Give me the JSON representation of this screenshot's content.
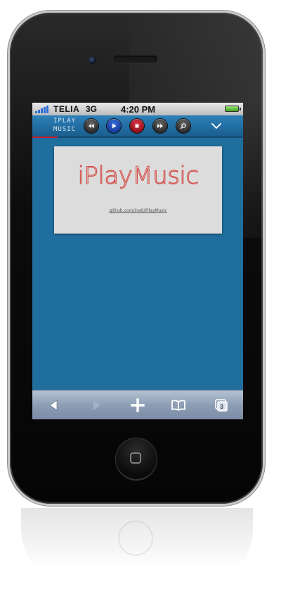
{
  "status_bar": {
    "carrier": "TELIA",
    "network": "3G",
    "time": "4:20 PM"
  },
  "player": {
    "logo_line1": "IPLAY",
    "logo_line2": "MUSIC",
    "controls": [
      "rewind-icon",
      "play-icon",
      "stop-icon",
      "fast-forward-icon",
      "search-icon"
    ],
    "menu_icon": "chevron-down-icon",
    "progress": 0.12
  },
  "card": {
    "title": "iPlayMusic",
    "link": "github.com/ina0/iPlayMusic"
  },
  "toolbar": {
    "buttons": [
      "back-icon",
      "forward-icon",
      "add-icon",
      "bookmarks-icon",
      "tabs-icon"
    ],
    "tab_count": "3"
  },
  "colors": {
    "page_background": "#1f6e9e",
    "player_bar": "#2c80b8",
    "title_red": "#d2443f",
    "progress_red": "#c2202b"
  }
}
